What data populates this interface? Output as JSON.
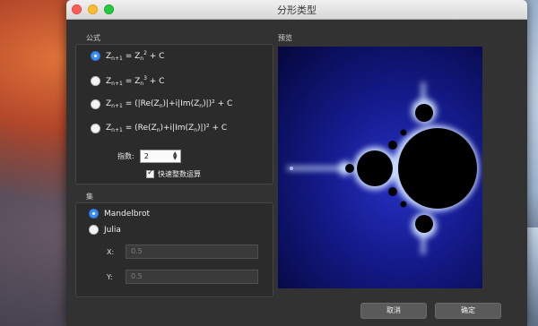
{
  "window": {
    "title": "分形类型"
  },
  "formula": {
    "label": "公式",
    "options": [
      {
        "id": "f1",
        "selected": true,
        "prefix": "Z",
        "prefix_sub": "n+1",
        "mid": " = Z",
        "mid_sub": "n",
        "mid_sup": "2",
        "tail": " + C"
      },
      {
        "id": "f2",
        "selected": false,
        "prefix": "Z",
        "prefix_sub": "n+1",
        "mid": " = Z",
        "mid_sub": "n",
        "mid_sup": "3",
        "tail": " + C"
      },
      {
        "id": "f3",
        "selected": false,
        "text": "= (|Re(Z",
        "text2": ")|+i|Im(Z",
        "text3": ")|)² + C",
        "prefix": "Z",
        "prefix_sub": "n+1",
        "sub_n": "n"
      },
      {
        "id": "f4",
        "selected": false,
        "text": "= (Re(Z",
        "text2": ")+i|Im(Z",
        "text3": ")|)² + C",
        "prefix": "Z",
        "prefix_sub": "n+1",
        "sub_n": "n"
      }
    ],
    "exponent_label": "指数:",
    "exponent_value": "2",
    "fast_integer_label": "快速整数运算",
    "fast_integer_checked": true
  },
  "set": {
    "label": "集",
    "options": [
      {
        "label": "Mandelbrot",
        "selected": true
      },
      {
        "label": "Julia",
        "selected": false
      }
    ],
    "x_label": "X:",
    "x_value": "0.5",
    "y_label": "Y:",
    "y_value": "0.5"
  },
  "preview": {
    "label": "预览"
  },
  "buttons": {
    "cancel": "取消",
    "ok": "确定"
  },
  "colors": {
    "accent": "#3d8ff6",
    "fractal_bg": "#141a8a",
    "fractal_edge": "#cfe0ff"
  }
}
